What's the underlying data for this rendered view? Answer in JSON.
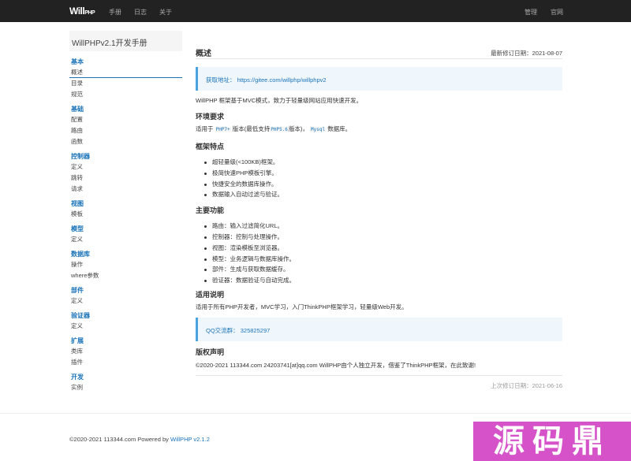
{
  "topbar": {
    "brand": "Will",
    "brand_small": "PHP",
    "nav": [
      "手册",
      "日志",
      "关于"
    ],
    "right": [
      "管理",
      "官网"
    ]
  },
  "sidebar": {
    "title": "WillPHPv2.1开发手册",
    "groups": [
      {
        "name": "基本",
        "items": [
          "概述",
          "目录",
          "规范"
        ]
      },
      {
        "name": "基础",
        "items": [
          "配置",
          "路由",
          "函数"
        ]
      },
      {
        "name": "控制器",
        "items": [
          "定义",
          "跳转",
          "请求"
        ]
      },
      {
        "name": "视图",
        "items": [
          "模板"
        ]
      },
      {
        "name": "模型",
        "items": [
          "定义"
        ]
      },
      {
        "name": "数据库",
        "items": [
          "操作",
          "where参数"
        ]
      },
      {
        "name": "部件",
        "items": [
          "定义"
        ]
      },
      {
        "name": "验证器",
        "items": [
          "定义"
        ]
      },
      {
        "name": "扩展",
        "items": [
          "类库",
          "插件"
        ]
      },
      {
        "name": "开发",
        "items": [
          "实例"
        ]
      }
    ]
  },
  "main": {
    "title": "概述",
    "revised": "最新修订日期：2021-08-07",
    "callout1": "获取地址：  https://gitee.com/willphp/willphpv2",
    "intro": "WillPHP 框架基于MVC模式，致力于轻量级网站应用快速开发。",
    "env_title": "环境要求",
    "env_pre": "适用于",
    "env_php": "PHP7+",
    "env_mid": "版本(最低支持",
    "env_php5": "PHP5.6",
    "env_mid2": "版本)，",
    "env_mysql": "Mysql",
    "env_post": "数据库。",
    "feat_title": "框架特点",
    "features": [
      "超轻量级(<100KB)框架。",
      "极简快速PHP模板引擎。",
      "快捷安全的数据库操作。",
      "数据输入自动过滤与验证。"
    ],
    "func_title": "主要功能",
    "functions": [
      "路由：输入过滤简化URL。",
      "控制器：控制与处理操作。",
      "视图：渲染模板至浏览器。",
      "模型：业务逻辑与数据库操作。",
      "部件：生成与获取数据缓存。",
      "验证器：数据验证与自动完成。"
    ],
    "use_title": "适用说明",
    "use_text": "适用于所有PHP开发者，MVC学习，入门ThinkPHP框架学习，轻量级Web开发。",
    "callout2": "QQ交流群：  325825297",
    "copy_title": "版权声明",
    "copy_text": "©2020-2021 113344.com 24203741[at]qq.com WillPHP由个人独立开发，借鉴了ThinkPHP框架，在此致谢!",
    "last_update": "上次修订日期：2021-06-16"
  },
  "footer": {
    "text": "©2020-2021 113344.com Powered by",
    "link": "WillPHP v2.1.2"
  },
  "watermark": "源码鼎"
}
